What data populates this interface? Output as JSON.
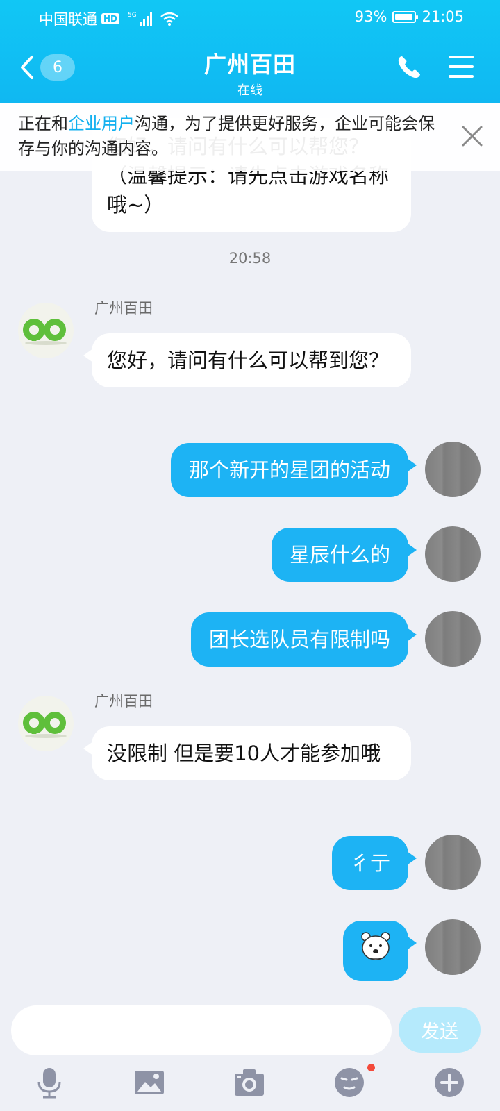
{
  "status_bar": {
    "carrier": "中国联通",
    "hd": "HD",
    "network": "5G",
    "battery": "93%",
    "battery_level": 0.93,
    "time": "21:05"
  },
  "header": {
    "unread_count": "6",
    "title": "广州百田",
    "subtitle": "在线"
  },
  "notice": {
    "prefix": "正在和",
    "highlight": "企业用户",
    "suffix": "沟通，为了提供更好服务，企业可能会保存与你的沟通内容。"
  },
  "colors": {
    "accent": "#11c0f4",
    "outgoing_bubble": "#1db3f4",
    "chat_background": "#eef0f6"
  },
  "messages": {
    "partial_top": "您好，请问有什么可以帮您？（温馨提示：请先点击游戏名称哦~）",
    "timestamp": "20:58",
    "sender_name": "广州百田",
    "m1": "您好，请问有什么可以帮到您？",
    "m2": "那个新开的星团的活动",
    "m3": "星辰什么的",
    "m4": "团长选队员有限制吗",
    "m5": "没限制 但是要10人才能参加哦",
    "m6": "彳亍",
    "m7_sticker": "bear-sticker"
  },
  "input": {
    "placeholder": "",
    "send_label": "发送"
  },
  "toolbar": [
    "mic-icon",
    "image-icon",
    "camera-icon",
    "emoji-icon",
    "plus-icon"
  ]
}
